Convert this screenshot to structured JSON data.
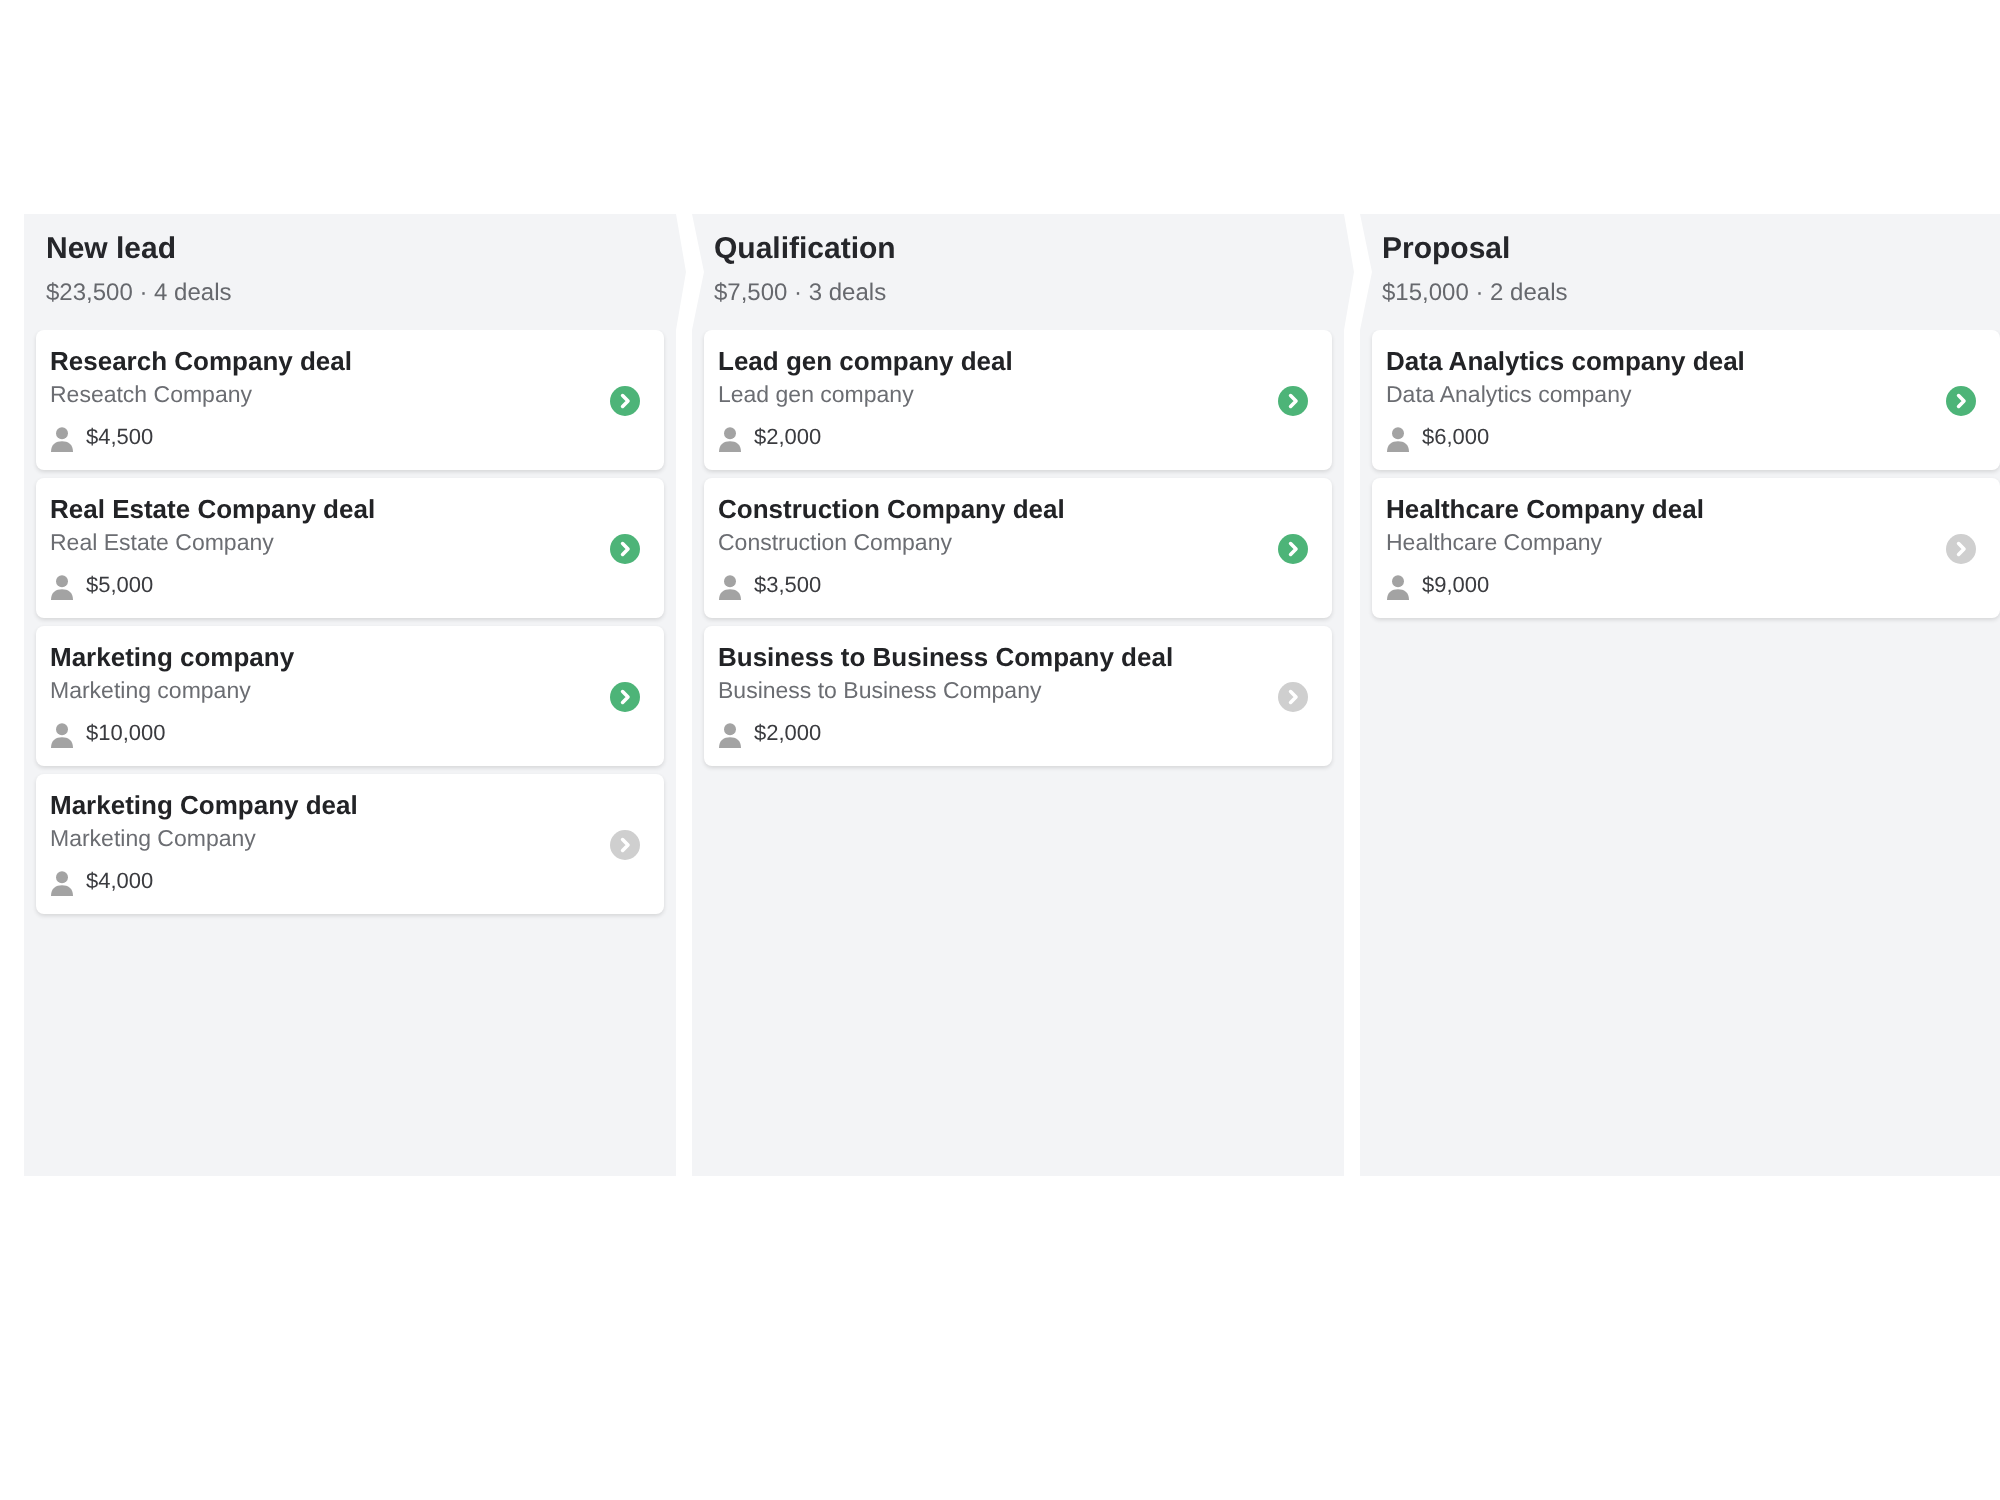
{
  "stages": [
    {
      "name": "New lead",
      "summary": "$23,500 · 4 deals",
      "deals": [
        {
          "title": "Research Company deal",
          "company": "Reseatch Company",
          "value": "$4,500",
          "activity_scheduled": true
        },
        {
          "title": "Real Estate Company deal",
          "company": "Real Estate Company",
          "value": "$5,000",
          "activity_scheduled": true
        },
        {
          "title": "Marketing company",
          "company": "Marketing company",
          "value": "$10,000",
          "activity_scheduled": true
        },
        {
          "title": "Marketing Company deal",
          "company": "Marketing Company",
          "value": "$4,000",
          "activity_scheduled": false
        }
      ]
    },
    {
      "name": "Qualification",
      "summary": "$7,500 · 3 deals",
      "deals": [
        {
          "title": "Lead gen company deal",
          "company": "Lead gen company",
          "value": "$2,000",
          "activity_scheduled": true
        },
        {
          "title": "Construction Company deal",
          "company": "Construction Company",
          "value": "$3,500",
          "activity_scheduled": true
        },
        {
          "title": "Business to Business Company deal",
          "company": "Business to Business Company",
          "value": "$2,000",
          "activity_scheduled": false
        }
      ]
    },
    {
      "name": "Proposal",
      "summary": "$15,000 · 2 deals",
      "deals": [
        {
          "title": "Data Analytics company deal",
          "company": "Data Analytics company",
          "value": "$6,000",
          "activity_scheduled": true
        },
        {
          "title": "Healthcare Company deal",
          "company": "Healthcare Company",
          "value": "$9,000",
          "activity_scheduled": false
        }
      ]
    }
  ]
}
